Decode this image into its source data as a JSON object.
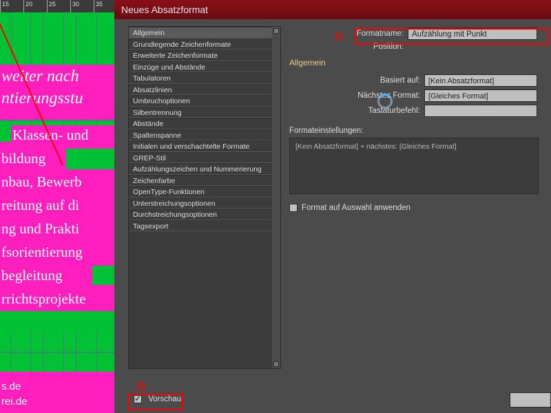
{
  "ruler": {
    "ticks": [
      "15",
      "20",
      "25",
      "30",
      "35"
    ]
  },
  "background_lines": {
    "l1": "weiter nach",
    "l2": "ntierungsstu",
    "l3": "Klassen- und",
    "l4": "bildung",
    "l5": "nbau, Bewerb",
    "l6": "reitung auf di",
    "l7": "ng und Prakti",
    "l8": "fsorientierung",
    "l9": "begleitung",
    "l10": "rrichtsprojekte",
    "url1": "s.de",
    "url2": "rei.de"
  },
  "dialog": {
    "title": "Neues Absatzformat",
    "categories": [
      "Allgemein",
      "Grundlegende Zeichenformate",
      "Erweiterte Zeichenformate",
      "Einzüge und Abstände",
      "Tabulatoren",
      "Absatzlinien",
      "Umbruchoptionen",
      "Silbentrennung",
      "Abstände",
      "Spaltenspanne",
      "Initialen und verschachtelte Formate",
      "GREP-Stil",
      "Aufzählungszeichen und Nummerierung",
      "Zeichenfarbe",
      "OpenType-Funktionen",
      "Unterstreichungsoptionen",
      "Durchstreichungsoptionen",
      "Tagsexport"
    ],
    "selected_category_index": 0,
    "formatname_label": "Formatname:",
    "formatname_value": "Aufzählung mit Punkt",
    "position_label": "Position:",
    "section_head": "Allgemein",
    "basiert_label": "Basiert auf:",
    "basiert_value": "[Kein Absatzformat]",
    "naechstes_label": "Nächstes Format:",
    "naechstes_value": "[Gleiches Format]",
    "tastatur_label": "Tastaturbefehl:",
    "tastatur_value": "",
    "settings_label": "Formateinstellungen:",
    "settings_value": "[Kein Absatzformat] + nächstes: [Gleiches Format]",
    "apply_label": "Format auf Auswahl anwenden",
    "vorschau_label": "Vorschau"
  },
  "callouts": {
    "num1": "1)",
    "num2": "2)"
  }
}
